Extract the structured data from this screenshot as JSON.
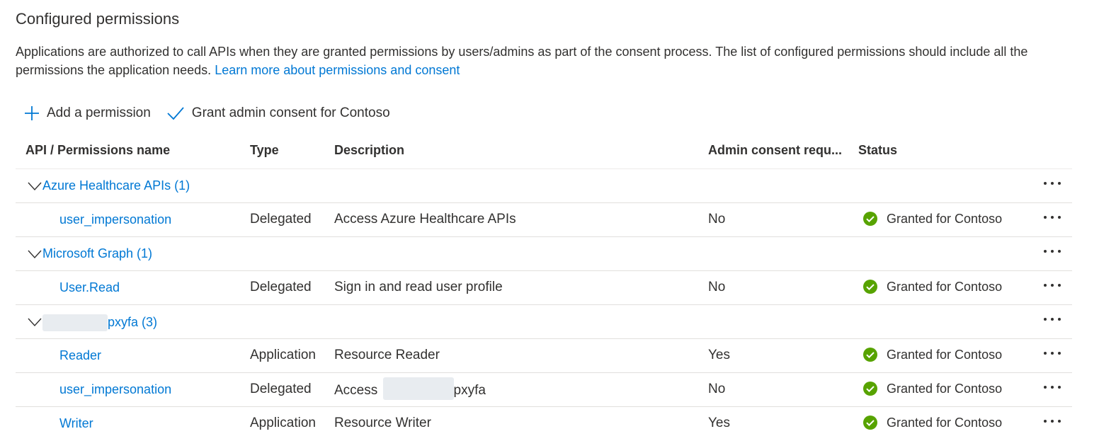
{
  "header": {
    "title": "Configured permissions",
    "description": "Applications are authorized to call APIs when they are granted permissions by users/admins as part of the consent process. The list of configured permissions should include all the permissions the application needs.",
    "learn_more": "Learn more about permissions and consent"
  },
  "toolbar": {
    "add_label": "Add a permission",
    "grant_label": "Grant admin consent for Contoso"
  },
  "columns": {
    "name": "API / Permissions name",
    "type": "Type",
    "description": "Description",
    "admin": "Admin consent requ...",
    "status": "Status"
  },
  "groups": [
    {
      "label": "Azure Healthcare APIs (1)"
    },
    {
      "label": "Microsoft Graph (1)"
    },
    {
      "label": "pxyfa (3)"
    }
  ],
  "rows": [
    {
      "name": "user_impersonation",
      "type": "Delegated",
      "description": "Access Azure Healthcare APIs",
      "admin": "No",
      "status": "Granted for Contoso"
    },
    {
      "name": "User.Read",
      "type": "Delegated",
      "description": "Sign in and read user profile",
      "admin": "No",
      "status": "Granted for Contoso"
    },
    {
      "name": "Reader",
      "type": "Application",
      "description": "Resource Reader",
      "admin": "Yes",
      "status": "Granted for Contoso"
    },
    {
      "name": "user_impersonation",
      "type": "Delegated",
      "description_prefix": "Access",
      "description_suffix": "pxyfa",
      "admin": "No",
      "status": "Granted for Contoso"
    },
    {
      "name": "Writer",
      "type": "Application",
      "description": "Resource Writer",
      "admin": "Yes",
      "status": "Granted for Contoso"
    }
  ],
  "colors": {
    "link": "#0078d4",
    "granted": "#57a300",
    "text": "#323130"
  },
  "icons": {
    "add": "plus-icon",
    "grant": "checkmark-icon",
    "granted": "check-circle-icon",
    "more": "more-icon",
    "expand": "chevron-down-icon"
  }
}
